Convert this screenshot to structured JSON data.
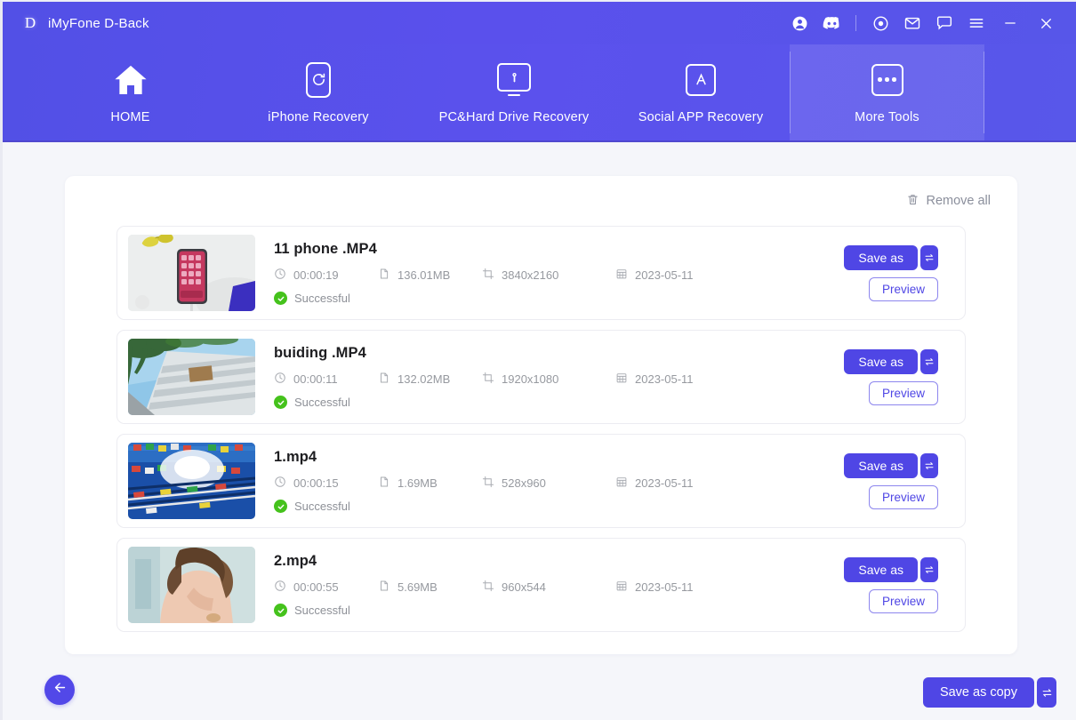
{
  "window": {
    "logo_letter": "D",
    "title": "iMyFone D-Back",
    "controls": [
      {
        "name": "account-icon",
        "label": "Account"
      },
      {
        "name": "discord-icon",
        "label": "Discord"
      },
      {
        "name": "target-icon",
        "label": "Record"
      },
      {
        "name": "mail-icon",
        "label": "Mail"
      },
      {
        "name": "chat-icon",
        "label": "Feedback"
      },
      {
        "name": "menu-icon",
        "label": "Menu"
      },
      {
        "name": "minimize-icon",
        "label": "Minimize"
      },
      {
        "name": "close-icon",
        "label": "Close"
      }
    ]
  },
  "nav": {
    "items": [
      {
        "label": "HOME",
        "icon": "home-icon",
        "active": false
      },
      {
        "label": "iPhone Recovery",
        "icon": "phone-refresh-icon",
        "active": false
      },
      {
        "label": "PC&Hard Drive Recovery",
        "icon": "monitor-key-icon",
        "active": false
      },
      {
        "label": "Social APP Recovery",
        "icon": "app-store-icon",
        "active": false
      },
      {
        "label": "More Tools",
        "icon": "ellipsis-icon",
        "active": true
      }
    ]
  },
  "panel": {
    "remove_all_label": "Remove all",
    "remove_all_icon": "trash-icon",
    "rows": [
      {
        "filename": "11 phone .MP4",
        "duration": "00:00:19",
        "size": "136.01MB",
        "resolution": "3840x2160",
        "date": "2023-05-11",
        "status": "Successful",
        "save_label": "Save as",
        "preview_label": "Preview",
        "thumb": "phone-on-desk"
      },
      {
        "filename": "buiding .MP4",
        "duration": "00:00:11",
        "size": "132.02MB",
        "resolution": "1920x1080",
        "date": "2023-05-11",
        "status": "Successful",
        "save_label": "Save as",
        "preview_label": "Preview",
        "thumb": "building-facade"
      },
      {
        "filename": "1.mp4",
        "duration": "00:00:15",
        "size": "1.69MB",
        "resolution": "528x960",
        "date": "2023-05-11",
        "status": "Successful",
        "save_label": "Save as",
        "preview_label": "Preview",
        "thumb": "blue-flags"
      },
      {
        "filename": "2.mp4",
        "duration": "00:00:55",
        "size": "5.69MB",
        "resolution": "960x544",
        "date": "2023-05-11",
        "status": "Successful",
        "save_label": "Save as",
        "preview_label": "Preview",
        "thumb": "portrait-woman"
      }
    ]
  },
  "footer": {
    "back_icon": "arrow-left-icon",
    "save_copy_label": "Save as copy",
    "dropdown_icon": "swap-arrows-icon"
  },
  "colors": {
    "brand_purple": "#4f46e5",
    "header_purple": "#5250e6",
    "page_bg": "#f5f6fa",
    "success_green": "#45c21c",
    "meta_gray": "#96999f"
  }
}
